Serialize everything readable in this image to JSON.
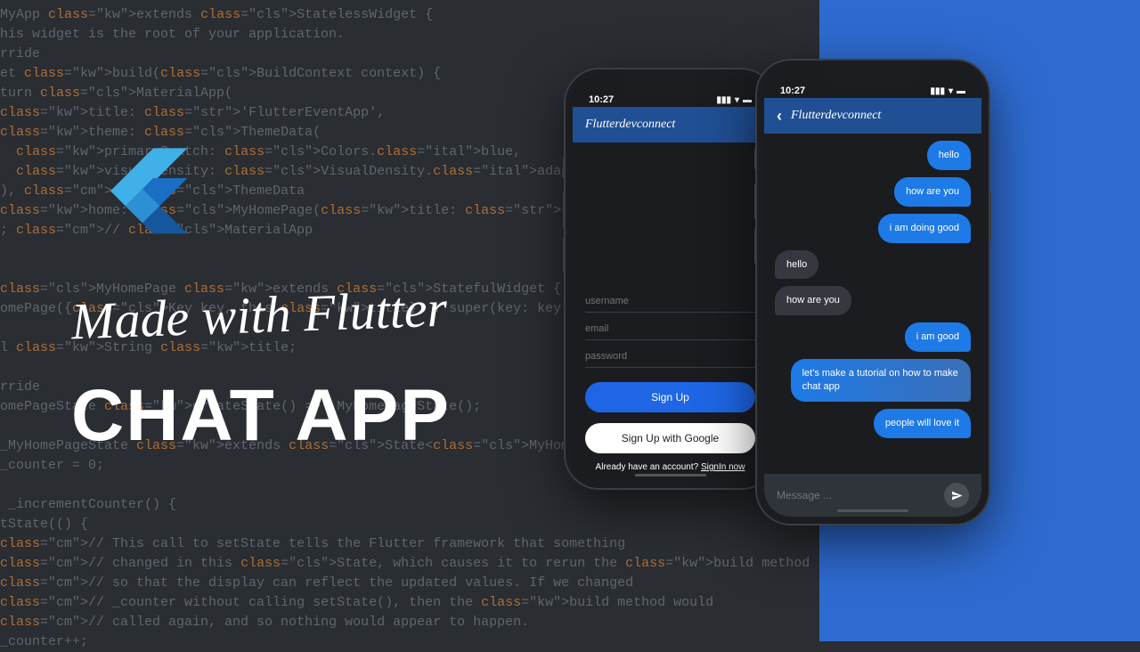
{
  "headline": {
    "script": "Made with Flutter",
    "main": "CHAT APP"
  },
  "code_lines": [
    "MyApp extends StatelessWidget {",
    "his widget is the root of your application.",
    "rride",
    "et build(BuildContext context) {",
    "turn MaterialApp(",
    "title: 'FlutterEventApp',",
    "theme: ThemeData(",
    "  primarySwatch: Colors.blue,",
    "  visualDensity: VisualDensity.adaptivePlatformDensity,",
    "), // ThemeData",
    "home: MyHomePage(title: 'Flutter Demo Home Page'),",
    "; // MaterialApp",
    "",
    "",
    "MyHomePage extends StatefulWidget {",
    "omePage({Key key, this.title}) : super(key: key);",
    "",
    "l String title;",
    "",
    "rride",
    "omePageState createState() => _MyHomePageState();",
    "",
    "_MyHomePageState extends State<MyHomePage> {",
    "_counter = 0;",
    "",
    " _incrementCounter() {",
    "tState(() {",
    "// This call to setState tells the Flutter framework that something",
    "// changed in this State, which causes it to rerun the build method",
    "// so that the display can reflect the updated values. If we changed",
    "// _counter without calling setState(), then the build method would",
    "// called again, and so nothing would appear to happen.",
    "_counter++;"
  ],
  "phone1": {
    "time": "10:27",
    "title": "Flutterdevconnect",
    "form": {
      "username_placeholder": "username",
      "email_placeholder": "email",
      "password_placeholder": "password",
      "signup_label": "Sign Up",
      "google_label": "Sign Up with Google",
      "already_text": "Already have an account? ",
      "signin_link": "SignIn now"
    }
  },
  "phone2": {
    "time": "10:27",
    "title": "Flutterdevconnect",
    "messages": [
      {
        "side": "out",
        "text": "hello"
      },
      {
        "side": "out",
        "text": "how are you"
      },
      {
        "side": "out",
        "text": "i am doing good"
      },
      {
        "side": "in",
        "text": "hello"
      },
      {
        "side": "in",
        "text": "how are you"
      },
      {
        "side": "out",
        "text": "i am good"
      },
      {
        "side": "out",
        "text": "let's make a tutorial on how to make chat app",
        "wide": true
      },
      {
        "side": "out",
        "text": "people will love it"
      }
    ],
    "compose_placeholder": "Message ..."
  }
}
